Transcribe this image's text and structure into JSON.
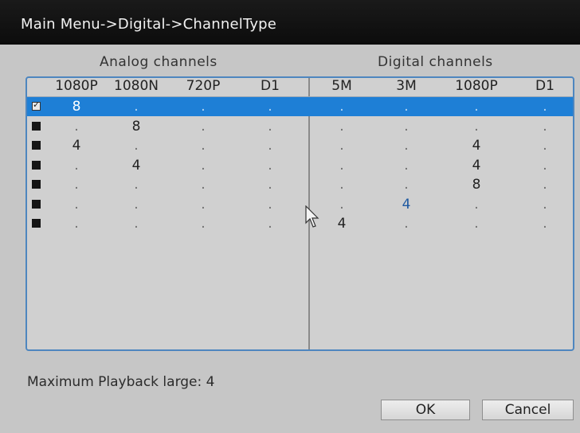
{
  "window": {
    "title": "Main Menu->Digital->ChannelType"
  },
  "sections": {
    "analog": "Analog channels",
    "digital": "Digital channels"
  },
  "columns": [
    "1080P",
    "1080N",
    "720P",
    "D1",
    "5M",
    "3M",
    "1080P",
    "D1"
  ],
  "rows": [
    {
      "checked": true,
      "cells": [
        "8",
        ".",
        ".",
        ".",
        ".",
        ".",
        ".",
        "."
      ]
    },
    {
      "checked": false,
      "cells": [
        ".",
        "8",
        ".",
        ".",
        ".",
        ".",
        ".",
        "."
      ]
    },
    {
      "checked": false,
      "cells": [
        "4",
        ".",
        ".",
        ".",
        ".",
        ".",
        "4",
        "."
      ]
    },
    {
      "checked": false,
      "cells": [
        ".",
        "4",
        ".",
        ".",
        ".",
        ".",
        "4",
        "."
      ]
    },
    {
      "checked": false,
      "cells": [
        ".",
        ".",
        ".",
        ".",
        ".",
        ".",
        "8",
        "."
      ]
    },
    {
      "checked": false,
      "cells": [
        ".",
        ".",
        ".",
        ".",
        ".",
        "4",
        ".",
        "."
      ]
    },
    {
      "checked": false,
      "cells": [
        ".",
        ".",
        ".",
        ".",
        "4",
        ".",
        ".",
        "."
      ]
    }
  ],
  "selected_row": 0,
  "status": "Maximum Playback large: 4",
  "buttons": {
    "ok": "OK",
    "cancel": "Cancel"
  },
  "colors": {
    "selection": "#1e7fd6",
    "panel_border": "#4e86bf",
    "highlight_value": "#1f5aa2"
  },
  "icons": {
    "cursor": "mouse-pointer-icon",
    "check": "checkbox-icon"
  }
}
